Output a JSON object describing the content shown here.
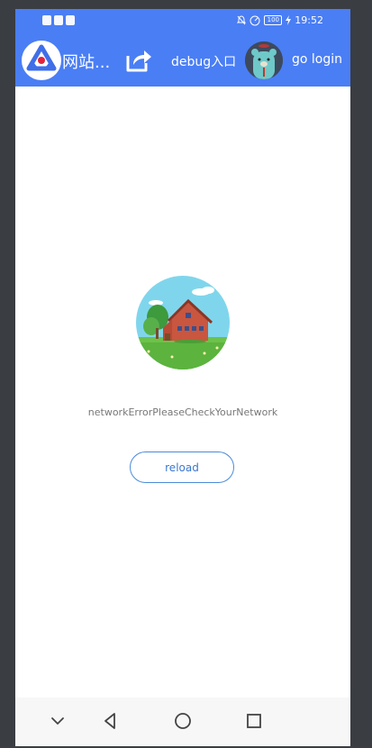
{
  "status_bar": {
    "time": "19:52",
    "battery": "100",
    "left_icons": [
      "notification-icon",
      "shield-icon",
      "message-icon"
    ],
    "right_icons": [
      "mute-icon",
      "speedometer-icon",
      "battery-icon",
      "charging-icon"
    ]
  },
  "app_bar": {
    "title": "网站...",
    "debug_label": "debug入口",
    "login_label": "go login",
    "logo_icon": "app-logo-icon",
    "share_icon": "share-icon",
    "avatar_icon": "bear-avatar",
    "background": "#4a7ef5"
  },
  "content": {
    "error_message": "networkErrorPleaseCheckYourNetwork",
    "reload_label": "reload",
    "illustration": "house-illustration",
    "accent": "#3a78d0"
  },
  "nav_bar": {
    "icons": [
      "collapse-icon",
      "back-icon",
      "home-icon",
      "recents-icon"
    ]
  }
}
